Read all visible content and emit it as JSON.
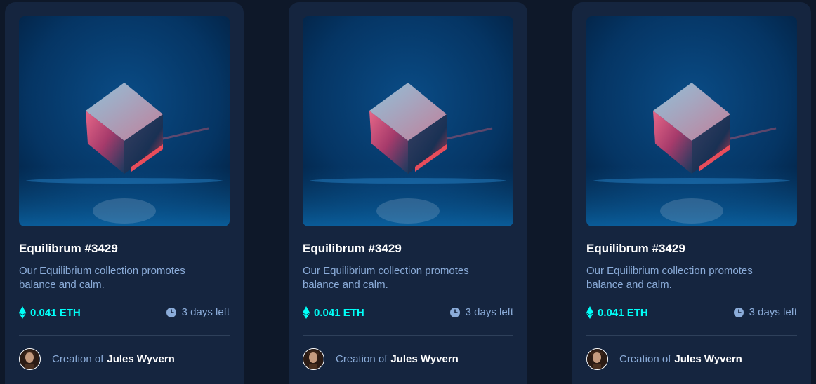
{
  "cards": [
    {
      "title": "Equilibrum #3429",
      "description": "Our Equilibrium collection promotes balance and calm.",
      "price": "0.041 ETH",
      "time_left": "3 days left",
      "creation_prefix": "Creation of",
      "creator": "Jules Wyvern"
    },
    {
      "title": "Equilibrum #3429",
      "description": "Our Equilibrium collection promotes balance and calm.",
      "price": "0.041 ETH",
      "time_left": "3 days left",
      "creation_prefix": "Creation of",
      "creator": "Jules Wyvern"
    },
    {
      "title": "Equilibrum #3429",
      "description": "Our Equilibrium collection promotes balance and calm.",
      "price": "0.041 ETH",
      "time_left": "3 days left",
      "creation_prefix": "Creation of",
      "creator": "Jules Wyvern"
    }
  ],
  "icons": {
    "price": "ethereum-icon",
    "time": "clock-icon"
  },
  "colors": {
    "page_background": "#0e1829",
    "card_background": "#15253f",
    "accent_cyan": "#00fff8",
    "soft_blue": "#8bacd9",
    "white": "#ffffff",
    "divider": "#2e405a"
  }
}
